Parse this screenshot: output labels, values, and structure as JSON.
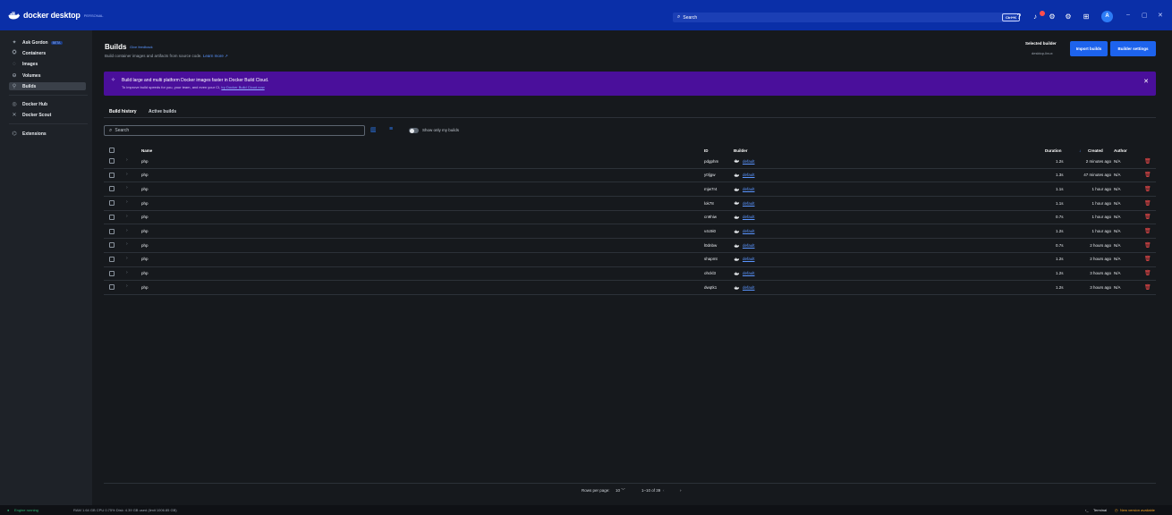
{
  "app": {
    "brand_name": "docker desktop",
    "brand_badge": "PERSONAL",
    "search_placeholder": "Search",
    "search_shortcut": "Ctrl+K",
    "avatar_letter": "A"
  },
  "sidebar": {
    "items": [
      {
        "label": "Ask Gordon",
        "badge": "BETA",
        "icon": "sparkle-icon"
      },
      {
        "label": "Containers",
        "icon": "containers-icon"
      },
      {
        "label": "Images",
        "icon": "images-icon"
      },
      {
        "label": "Volumes",
        "icon": "volumes-icon"
      },
      {
        "label": "Builds",
        "icon": "builds-icon"
      },
      {
        "label": "Docker Hub",
        "icon": "hub-icon"
      },
      {
        "label": "Docker Scout",
        "icon": "scout-icon"
      },
      {
        "label": "Extensions",
        "icon": "extensions-icon"
      }
    ]
  },
  "header": {
    "title": "Builds",
    "feedback": "Give feedback",
    "subtitle": "Build container images and artifacts from source code.",
    "learn_more": "Learn more",
    "selected_builder_label": "Selected builder",
    "selected_builder_value": "desktop-linux",
    "import_button": "Import builds",
    "settings_button": "Builder settings"
  },
  "banner": {
    "line1": "Build large and multi platform Docker images faster in Docker Build Cloud.",
    "line2": "To improve build speeds for you, your team, and even your CI,",
    "line2_link": "try Docker Build Cloud now"
  },
  "tabs": [
    "Build history",
    "Active builds"
  ],
  "toolbar": {
    "search_placeholder": "Search",
    "toggle_label": "Show only my builds"
  },
  "table": {
    "headers": {
      "name": "Name",
      "id": "ID",
      "builder": "Builder",
      "duration": "Duration",
      "created": "Created",
      "author": "Author"
    },
    "rows": [
      {
        "name": "php",
        "id": "pdgphm",
        "builder": "default",
        "duration": "1.2s",
        "created": "2 minutes ago",
        "author": "N/A"
      },
      {
        "name": "php",
        "id": "y0ljgw",
        "builder": "default",
        "duration": "1.3s",
        "created": "47 minutes ago",
        "author": "N/A"
      },
      {
        "name": "php",
        "id": "mjw7r4",
        "builder": "default",
        "duration": "1.1s",
        "created": "1 hour ago",
        "author": "N/A"
      },
      {
        "name": "php",
        "id": "lok78",
        "builder": "default",
        "duration": "1.1s",
        "created": "1 hour ago",
        "author": "N/A"
      },
      {
        "name": "php",
        "id": "cn9hiw",
        "builder": "default",
        "duration": "0.7s",
        "created": "1 hour ago",
        "author": "N/A"
      },
      {
        "name": "php",
        "id": "v4c9i0",
        "builder": "default",
        "duration": "1.2s",
        "created": "1 hour ago",
        "author": "N/A"
      },
      {
        "name": "php",
        "id": "l0dnbw",
        "builder": "default",
        "duration": "0.7s",
        "created": "2 hours ago",
        "author": "N/A"
      },
      {
        "name": "php",
        "id": "shapmt",
        "builder": "default",
        "duration": "1.2s",
        "created": "2 hours ago",
        "author": "N/A"
      },
      {
        "name": "php",
        "id": "ohckl3",
        "builder": "default",
        "duration": "1.2s",
        "created": "3 hours ago",
        "author": "N/A"
      },
      {
        "name": "php",
        "id": "dwqtk1",
        "builder": "default",
        "duration": "1.2s",
        "created": "3 hours ago",
        "author": "N/A"
      }
    ]
  },
  "pagination": {
    "rows_per_page_label": "Rows per page:",
    "rows_per_page": "10",
    "range": "1–10 of 39"
  },
  "statusbar": {
    "engine": "Engine running",
    "stats": "RAM 1.64 GB  CPU 0.75%  Disk: 4.39 GB used (limit 1006.85 GB)",
    "terminal": "Terminal",
    "update": "New version available"
  },
  "colors": {
    "topbar": "#0a2fa8",
    "accent": "#1d63ed",
    "banner": "#4a0f9b",
    "danger": "#ff4d4d"
  }
}
